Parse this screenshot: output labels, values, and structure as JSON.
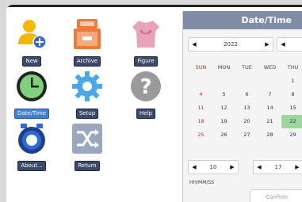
{
  "apps": [
    {
      "label": "New",
      "icon": "add-user-icon",
      "active": false
    },
    {
      "label": "Archive",
      "icon": "archive-drawer-icon",
      "active": false
    },
    {
      "label": "Figure",
      "icon": "body-figure-icon",
      "active": false
    },
    {
      "label": "Date/Time",
      "icon": "clock-icon",
      "active": true
    },
    {
      "label": "Setup",
      "icon": "gear-icon",
      "active": false
    },
    {
      "label": "Help",
      "icon": "question-icon",
      "active": false
    },
    {
      "label": "About...",
      "icon": "about-icon",
      "active": false
    },
    {
      "label": "Return",
      "icon": "shuffle-return-icon",
      "active": false
    }
  ],
  "dialog": {
    "title": "Date/Time",
    "year": "2022",
    "month_prev": "◀",
    "weekdays": [
      "SUN",
      "MON",
      "TUE",
      "WED",
      "THU"
    ],
    "weeks": [
      [
        "",
        "",
        "",
        "",
        "1"
      ],
      [
        "4",
        "5",
        "6",
        "7",
        "8"
      ],
      [
        "11",
        "12",
        "13",
        "14",
        "15"
      ],
      [
        "18",
        "19",
        "20",
        "21",
        "22"
      ],
      [
        "25",
        "26",
        "27",
        "28",
        "29"
      ]
    ],
    "selected_day": "22",
    "hour": "10",
    "minute": "17",
    "time_format": "HH/MM/SS",
    "confirm_label": "Confirm"
  },
  "colors": {
    "label_bg": "#3b4a6b",
    "label_active_bg": "#3f7fd9",
    "dialog_title_bg": "#7f8da6",
    "selected_day_bg": "#9fd69f",
    "weekend": "#c03030"
  }
}
